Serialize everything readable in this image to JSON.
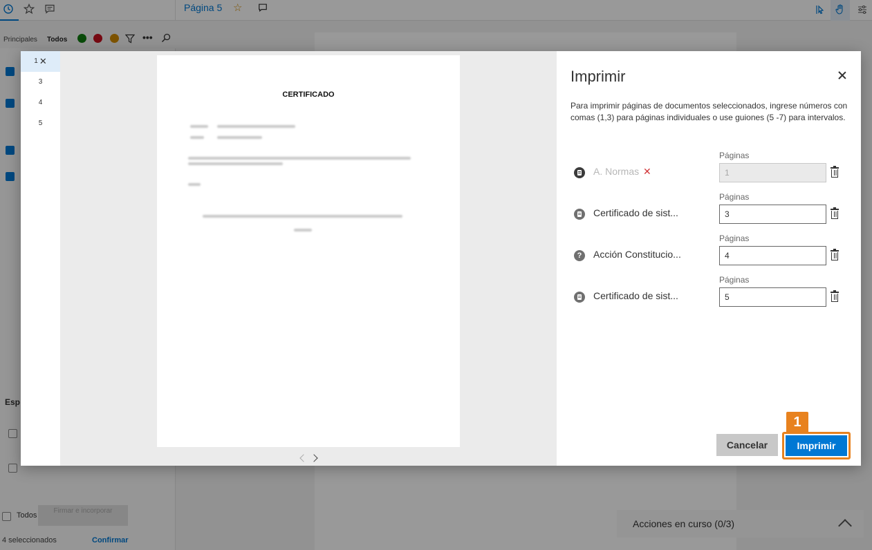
{
  "background": {
    "page_title": "Página 5",
    "filter_tabs": [
      "Principales",
      "Todos"
    ],
    "section_label": "Esp",
    "todos_label": "Todos",
    "firmar_button": "Firmar e incorporar",
    "selected_count": "4 seleccionados",
    "confirm_label": "Confirmar",
    "actions_label": "Acciones en curso (0/3)"
  },
  "thumbnails": [
    "1",
    "3",
    "4",
    "5"
  ],
  "preview": {
    "document_heading": "CERTIFICADO"
  },
  "print_panel": {
    "title": "Imprimir",
    "instructions": "Para imprimir páginas de documentos seleccionados, ingrese números con comas (1,3) para páginas individuales o use guiones (5 -7) para intervalos.",
    "pages_label": "Páginas",
    "documents": [
      {
        "name": "A. Normas",
        "icon": "document-icon",
        "pages": "1",
        "disabled": true,
        "remove_mark": "✕"
      },
      {
        "name": "Certificado de sist...",
        "icon": "document-icon",
        "pages": "3",
        "disabled": false
      },
      {
        "name": "Acción Constitucio...",
        "icon": "question-icon",
        "pages": "4",
        "disabled": false
      },
      {
        "name": "Certificado de sist...",
        "icon": "document-icon",
        "pages": "5",
        "disabled": false
      }
    ],
    "cancel_label": "Cancelar",
    "print_label": "Imprimir",
    "step_number": "1"
  },
  "colors": {
    "accent": "#0078d4",
    "highlight": "#e8821e",
    "remove": "#d13438"
  }
}
